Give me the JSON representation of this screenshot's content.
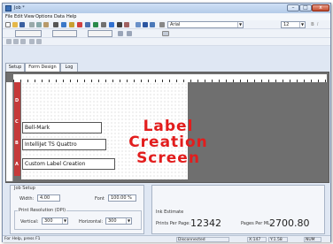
{
  "window": {
    "title": "Job *",
    "minimize_label": "–",
    "maximize_label": "□",
    "close_label": "x"
  },
  "menu": [
    "File",
    "Edit",
    "View",
    "Options",
    "Data",
    "Help"
  ],
  "toolbar": {
    "font_name": "Arial",
    "font_size": "12"
  },
  "tabs": [
    {
      "label": "Setup",
      "active": false
    },
    {
      "label": "Form Design",
      "active": true
    },
    {
      "label": "Log",
      "active": false
    }
  ],
  "canvas": {
    "strip_letters": [
      "D",
      "C",
      "B",
      "A"
    ],
    "label_rows": [
      "Bell-Mark",
      "IntelliJet TS Quattro",
      "Custom Label Creation"
    ],
    "overlay_text": [
      "Label",
      "Creation",
      "Screen"
    ]
  },
  "job_setup": {
    "title": "Job Setup",
    "width_label": "Width:",
    "width_value": "4.00",
    "font_label": "Font",
    "font_value": "100.00 %",
    "print_resolution_title": "Print Resolution (DPI)",
    "vertical_label": "Vertical:",
    "vertical_value": "300",
    "horizontal_label": "Horizontal:",
    "horizontal_value": "300"
  },
  "ink_estimate": {
    "title": "Ink Estimate",
    "prints_per_page_label": "Prints Per Page:",
    "prints_per_page_value": "12342",
    "pages_per_ml_label": "Pages Per ML:",
    "pages_per_ml_value": "2700.80"
  },
  "statusbar": {
    "help_text": "For Help, press F1",
    "connection": "Disconnected",
    "coord1": "X:147",
    "coord2": "Y:1.58",
    "num": "NUM"
  },
  "colors": {
    "strip_red": "#c53a3a",
    "overlay_red": "#e21d1d"
  }
}
